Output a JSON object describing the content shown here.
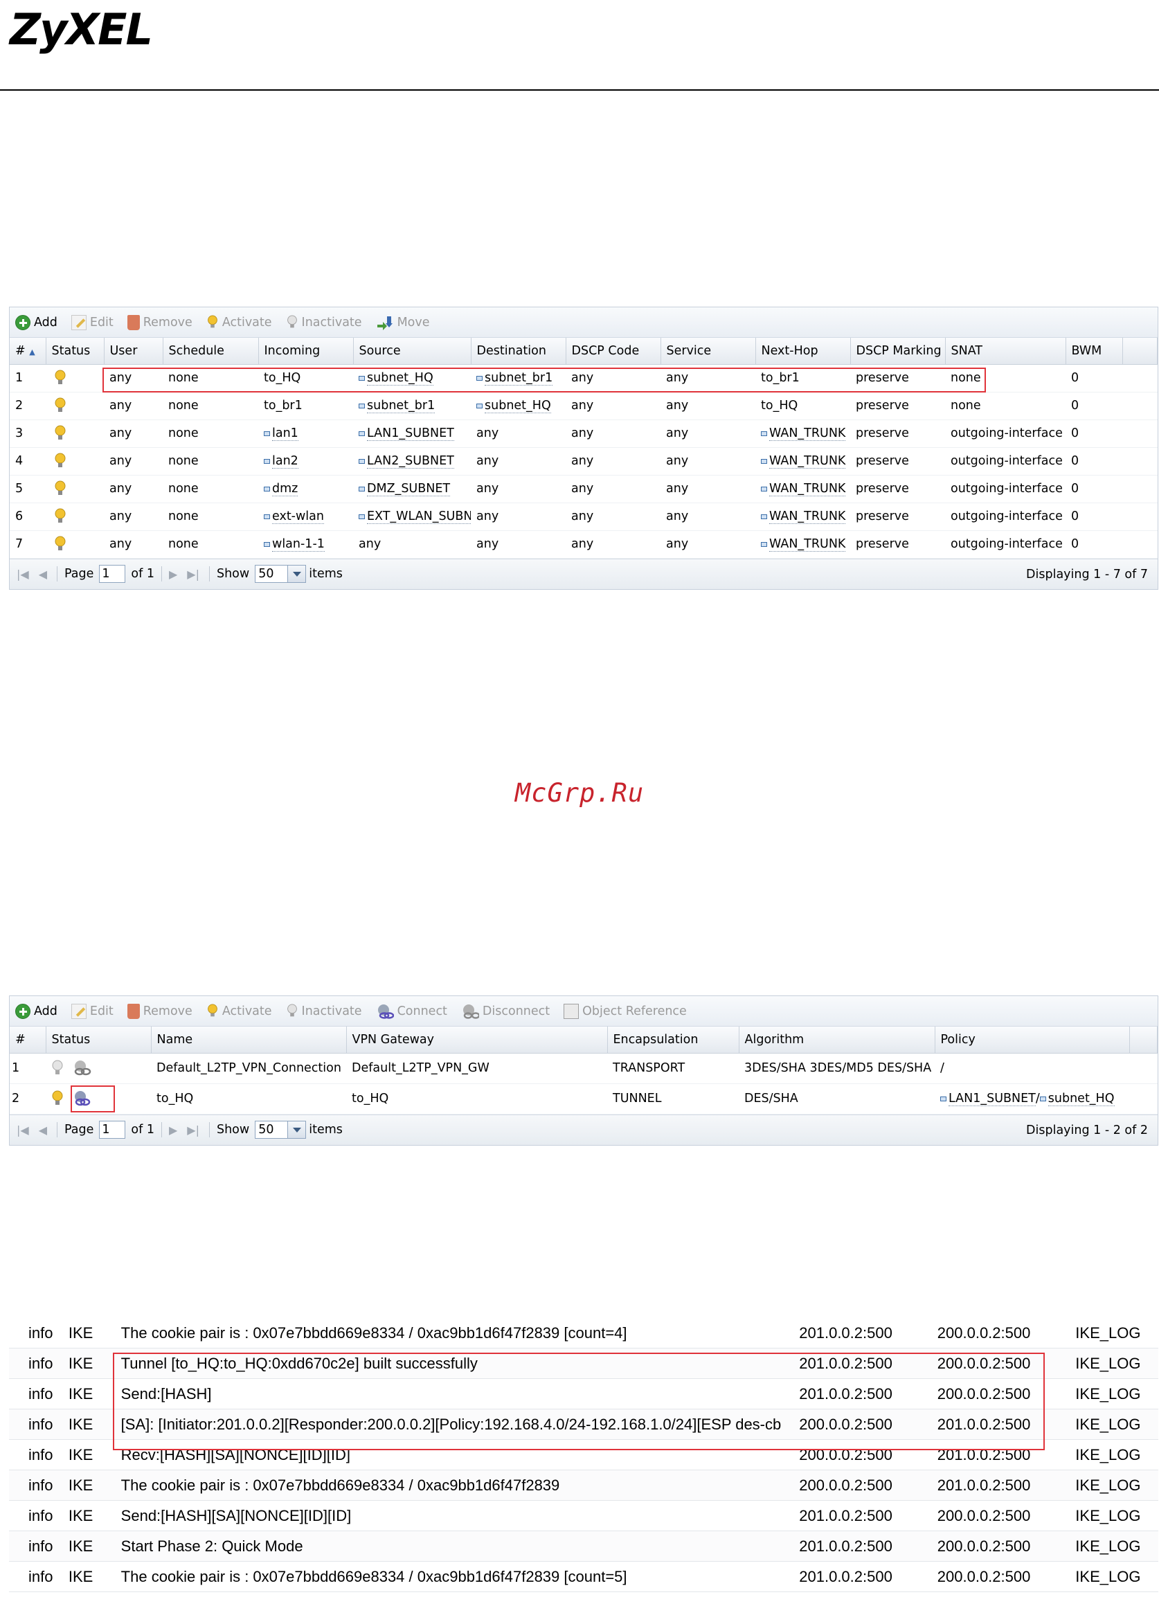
{
  "header": {
    "logo": "ZyXEL"
  },
  "watermark": "McGrp.Ru",
  "policy_route": {
    "toolbar": [
      {
        "label": "Add",
        "icon": "add-icon",
        "enabled": true
      },
      {
        "label": "Edit",
        "icon": "edit-icon",
        "enabled": false
      },
      {
        "label": "Remove",
        "icon": "remove-icon",
        "enabled": false
      },
      {
        "label": "Activate",
        "icon": "activate-bulb-icon",
        "enabled": false
      },
      {
        "label": "Inactivate",
        "icon": "inactivate-bulb-icon",
        "enabled": false
      },
      {
        "label": "Move",
        "icon": "move-icon",
        "enabled": false
      }
    ],
    "columns": [
      "#",
      "Status",
      "User",
      "Schedule",
      "Incoming",
      "Source",
      "Destination",
      "DSCP Code",
      "Service",
      "Next-Hop",
      "DSCP Marking",
      "SNAT",
      "BWM"
    ],
    "sort_indicator": "▲",
    "rows": [
      {
        "n": "1",
        "user": "any",
        "schedule": "none",
        "incoming": "to_HQ",
        "source": "subnet_HQ",
        "destination": "subnet_br1",
        "dscp": "any",
        "service": "any",
        "nexthop": "to_br1",
        "marking": "preserve",
        "snat": "none",
        "bwm": "0"
      },
      {
        "n": "2",
        "user": "any",
        "schedule": "none",
        "incoming": "to_br1",
        "source": "subnet_br1",
        "destination": "subnet_HQ",
        "dscp": "any",
        "service": "any",
        "nexthop": "to_HQ",
        "marking": "preserve",
        "snat": "none",
        "bwm": "0"
      },
      {
        "n": "3",
        "user": "any",
        "schedule": "none",
        "incoming": "lan1",
        "source": "LAN1_SUBNET",
        "destination": "any",
        "dscp": "any",
        "service": "any",
        "nexthop": "WAN_TRUNK",
        "marking": "preserve",
        "snat": "outgoing-interface",
        "bwm": "0"
      },
      {
        "n": "4",
        "user": "any",
        "schedule": "none",
        "incoming": "lan2",
        "source": "LAN2_SUBNET",
        "destination": "any",
        "dscp": "any",
        "service": "any",
        "nexthop": "WAN_TRUNK",
        "marking": "preserve",
        "snat": "outgoing-interface",
        "bwm": "0"
      },
      {
        "n": "5",
        "user": "any",
        "schedule": "none",
        "incoming": "dmz",
        "source": "DMZ_SUBNET",
        "destination": "any",
        "dscp": "any",
        "service": "any",
        "nexthop": "WAN_TRUNK",
        "marking": "preserve",
        "snat": "outgoing-interface",
        "bwm": "0"
      },
      {
        "n": "6",
        "user": "any",
        "schedule": "none",
        "incoming": "ext-wlan",
        "source": "EXT_WLAN_SUBN",
        "destination": "any",
        "dscp": "any",
        "service": "any",
        "nexthop": "WAN_TRUNK",
        "marking": "preserve",
        "snat": "outgoing-interface",
        "bwm": "0"
      },
      {
        "n": "7",
        "user": "any",
        "schedule": "none",
        "incoming": "wlan-1-1",
        "source": "any",
        "destination": "any",
        "dscp": "any",
        "service": "any",
        "nexthop": "WAN_TRUNK",
        "marking": "preserve",
        "snat": "outgoing-interface",
        "bwm": "0"
      }
    ],
    "pager": {
      "page_label": "Page",
      "page": "1",
      "of_label": "of 1",
      "show_label": "Show",
      "show_value": "50",
      "items_label": "items",
      "display": "Displaying 1 - 7 of 7"
    }
  },
  "vpn_connection": {
    "toolbar": [
      {
        "label": "Add",
        "icon": "add-icon",
        "enabled": true
      },
      {
        "label": "Edit",
        "icon": "edit-icon",
        "enabled": false
      },
      {
        "label": "Remove",
        "icon": "remove-icon",
        "enabled": false
      },
      {
        "label": "Activate",
        "icon": "activate-bulb-icon",
        "enabled": false
      },
      {
        "label": "Inactivate",
        "icon": "inactivate-bulb-icon",
        "enabled": false
      },
      {
        "label": "Connect",
        "icon": "connect-icon",
        "enabled": false
      },
      {
        "label": "Disconnect",
        "icon": "disconnect-icon",
        "enabled": false
      },
      {
        "label": "Object Reference",
        "icon": "object-reference-icon",
        "enabled": false
      }
    ],
    "columns": [
      "#",
      "Status",
      "Name",
      "VPN Gateway",
      "Encapsulation",
      "Algorithm",
      "Policy"
    ],
    "rows": [
      {
        "n": "1",
        "active": false,
        "name": "Default_L2TP_VPN_Connection",
        "gateway": "Default_L2TP_VPN_GW",
        "encapsulation": "TRANSPORT",
        "algorithm": "3DES/SHA 3DES/MD5 DES/SHA",
        "policy_local": "",
        "policy_sep": "/",
        "policy_remote": ""
      },
      {
        "n": "2",
        "active": true,
        "name": "to_HQ",
        "gateway": "to_HQ",
        "encapsulation": "TUNNEL",
        "algorithm": "DES/SHA",
        "policy_local": "LAN1_SUBNET",
        "policy_sep": "/",
        "policy_remote": "subnet_HQ"
      }
    ],
    "pager": {
      "page_label": "Page",
      "page": "1",
      "of_label": "of 1",
      "show_label": "Show",
      "show_value": "50",
      "items_label": "items",
      "display": "Displaying 1 - 2 of 2"
    }
  },
  "log": {
    "rows": [
      {
        "priority": "info",
        "category": "IKE",
        "message": "The cookie pair is : 0x07e7bbdd669e8334 / 0xac9bb1d6f47f2839 [count=4]",
        "source": "201.0.0.2:500",
        "destination": "200.0.0.2:500",
        "note": "IKE_LOG"
      },
      {
        "priority": "info",
        "category": "IKE",
        "message": "Tunnel [to_HQ:to_HQ:0xdd670c2e] built successfully",
        "source": "201.0.0.2:500",
        "destination": "200.0.0.2:500",
        "note": "IKE_LOG"
      },
      {
        "priority": "info",
        "category": "IKE",
        "message": "Send:[HASH]",
        "source": "201.0.0.2:500",
        "destination": "200.0.0.2:500",
        "note": "IKE_LOG"
      },
      {
        "priority": "info",
        "category": "IKE",
        "message": "[SA]: [Initiator:201.0.0.2][Responder:200.0.0.2][Policy:192.168.4.0/24-192.168.1.0/24][ESP des-cb",
        "source": "200.0.0.2:500",
        "destination": "201.0.0.2:500",
        "note": "IKE_LOG"
      },
      {
        "priority": "info",
        "category": "IKE",
        "message": "Recv:[HASH][SA][NONCE][ID][ID]",
        "source": "200.0.0.2:500",
        "destination": "201.0.0.2:500",
        "note": "IKE_LOG"
      },
      {
        "priority": "info",
        "category": "IKE",
        "message": "The cookie pair is : 0x07e7bbdd669e8334 / 0xac9bb1d6f47f2839",
        "source": "200.0.0.2:500",
        "destination": "201.0.0.2:500",
        "note": "IKE_LOG"
      },
      {
        "priority": "info",
        "category": "IKE",
        "message": "Send:[HASH][SA][NONCE][ID][ID]",
        "source": "201.0.0.2:500",
        "destination": "200.0.0.2:500",
        "note": "IKE_LOG"
      },
      {
        "priority": "info",
        "category": "IKE",
        "message": "Start Phase 2: Quick Mode",
        "source": "201.0.0.2:500",
        "destination": "200.0.0.2:500",
        "note": "IKE_LOG"
      },
      {
        "priority": "info",
        "category": "IKE",
        "message": "The cookie pair is : 0x07e7bbdd669e8334 / 0xac9bb1d6f47f2839 [count=5]",
        "source": "201.0.0.2:500",
        "destination": "200.0.0.2:500",
        "note": "IKE_LOG"
      }
    ]
  },
  "colors": {
    "highlight_box": "#e0333a",
    "watermark": "#c8232c",
    "bulb_on": "#f2c230",
    "bulb_off": "#c8c8c8",
    "chain_on": "#5a4fb8"
  }
}
